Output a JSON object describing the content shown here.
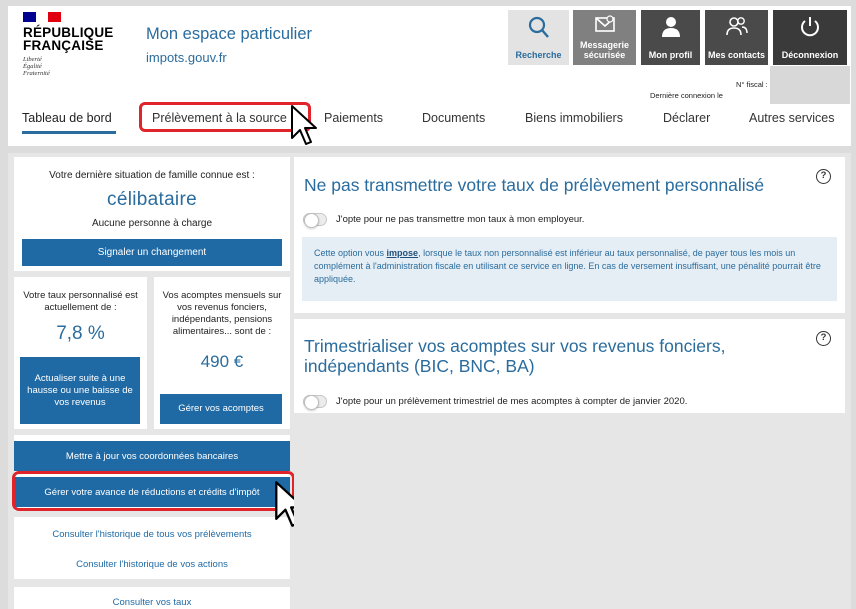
{
  "header": {
    "republic": [
      "RÉPUBLIQUE",
      "FRANÇAISE"
    ],
    "motto": [
      "Liberté",
      "Égalité",
      "Fraternité"
    ],
    "space_title_prefix": "Mon espace",
    "space_title_suffix": "particulier",
    "site": "impots.gouv.fr",
    "buttons": {
      "search": "Recherche",
      "messaging_line1": "Messagerie",
      "messaging_line2": "sécurisée",
      "profile": "Mon profil",
      "contacts": "Mes contacts",
      "logout": "Déconnexion"
    },
    "fiscal_number_label": "N° fiscal :",
    "last_connection_label": "Dernière connexion le"
  },
  "nav": {
    "tabs": [
      "Tableau de bord",
      "Prélèvement à la source",
      "Paiements",
      "Documents",
      "Biens immobiliers",
      "Déclarer",
      "Autres services"
    ],
    "active_index": 0
  },
  "left": {
    "family_label": "Votre dernière situation de famille connue est :",
    "family_value": "célibataire",
    "dependents": "Aucune personne à charge",
    "signal_button": "Signaler un changement",
    "rate_label": "Votre taux personnalisé est actuellement de :",
    "rate_value": "7,8 %",
    "update_rate_button": "Actualiser suite à une hausse ou une baisse de vos revenus",
    "installments_label": "Vos acomptes mensuels sur vos revenus fonciers, indépendants, pensions alimentaires... sont de :",
    "installments_value": "490 €",
    "manage_installments_button": "Gérer vos acomptes",
    "bank_button": "Mettre à jour vos coordonnées bancaires",
    "reductions_button": "Gérer votre avance de réductions et crédits d'impôt",
    "history_link": "Consulter l'historique de tous vos prélèvements",
    "actions_link": "Consulter l'historique de vos actions",
    "rates_link": "Consulter vos taux"
  },
  "right": {
    "card1": {
      "title": "Ne pas transmettre votre taux de prélèvement personnalisé",
      "option": "J'opte pour ne pas transmettre mon taux à mon employeur.",
      "info_before": "Cette option vous ",
      "info_emph": "impose",
      "info_after": ", lorsque le taux non personnalisé est inférieur au taux personnalisé, de payer tous les mois un complément à l'administration fiscale en utilisant ce service en ligne. En cas de versement insuffisant, une pénalité pourrait être appliquée."
    },
    "card2": {
      "title_before": "Trimestrialiser vos acomptes sur vos revenus fonciers, indépendants (",
      "bic": "BIC",
      "sep1": ", ",
      "bnc": "BNC",
      "sep2": ", ",
      "ba": "BA",
      "title_after": ")",
      "option": "J'opte pour un prélèvement trimestriel de mes acomptes à compter de janvier 2020."
    },
    "help_symbol": "?"
  },
  "colors": {
    "brand_blue": "#2a6c9d",
    "button_blue": "#1f6aa5",
    "highlight_red": "#e0242a",
    "flag_blue": "#000091",
    "flag_red": "#e1000f"
  }
}
